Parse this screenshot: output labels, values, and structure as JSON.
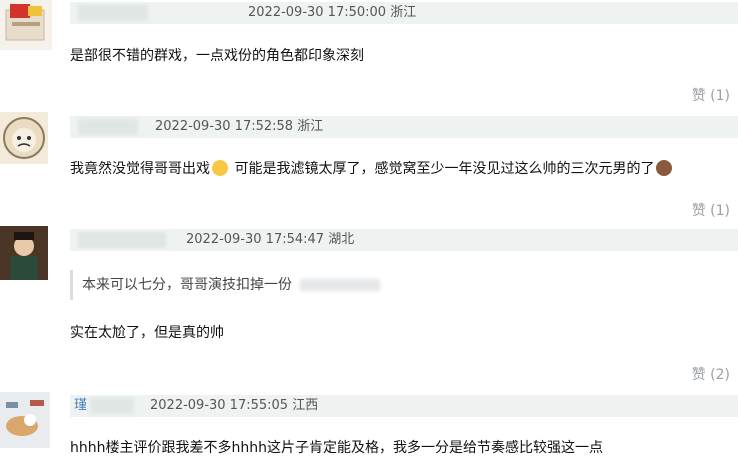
{
  "comments": [
    {
      "meta": "2022-09-30 17:50:00 浙江",
      "text": "是部很不错的群戏，一点戏份的角色都印象深刻",
      "like": "赞 (1)"
    },
    {
      "meta": "2022-09-30 17:52:58 浙江",
      "text_part1": "我竟然没觉得哥哥出戏",
      "text_part2": " 可能是我滤镜太厚了，感觉窝至少一年没见过这么帅的三次元男的了",
      "like": "赞 (1)"
    },
    {
      "meta": "2022-09-30 17:54:47 湖北",
      "quote": "本来可以七分，哥哥演技扣掉一份",
      "text": "实在太尬了，但是真的帅",
      "like": "赞 (2)"
    },
    {
      "meta": "2022-09-30 17:55:05 江西",
      "name_partial": "瑾",
      "text": "hhhh楼主评价跟我差不多hhhh这片子肯定能及格，我多一分是给节奏感比较强这一点"
    }
  ],
  "colors": {
    "header_bg": "#eef3f1",
    "like_gray": "#9aa0a6"
  }
}
